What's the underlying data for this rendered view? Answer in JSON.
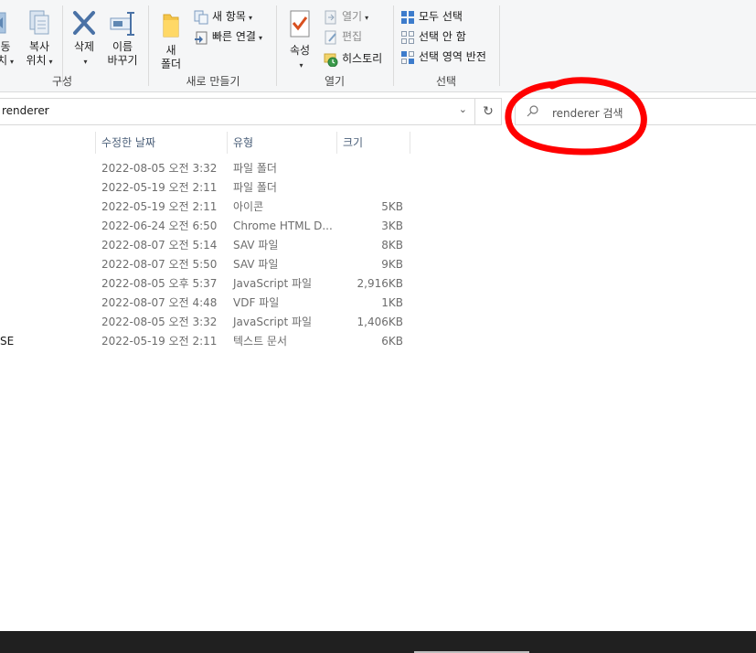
{
  "ribbon": {
    "cut_left": {
      "line1": "동",
      "line2": "치"
    },
    "copy_to": {
      "line1": "복사",
      "line2": "위치"
    },
    "delete": {
      "line1": "삭제",
      "line2": ""
    },
    "rename": {
      "line1": "이름",
      "line2": "바꾸기"
    },
    "organize_label": "구성",
    "new_folder": {
      "line1": "새",
      "line2": "폴더"
    },
    "new_item": "새 항목",
    "easy_access": "빠른 연결",
    "new_label": "새로 만들기",
    "properties": "속성",
    "open": "열기",
    "edit": "편집",
    "history": "히스토리",
    "open_label": "열기",
    "select_all": "모두 선택",
    "select_none": "선택 안 함",
    "invert_selection": "선택 영역 반전",
    "select_label": "선택"
  },
  "address": {
    "path": "renderer"
  },
  "search": {
    "placeholder": "renderer 검색"
  },
  "columns": {
    "date": "수정한 날짜",
    "type": "유형",
    "size": "크기"
  },
  "files": [
    {
      "name": "",
      "date": "2022-08-05 오전 3:32",
      "type": "파일 폴더",
      "size": ""
    },
    {
      "name": "",
      "date": "2022-05-19 오전 2:11",
      "type": "파일 폴더",
      "size": ""
    },
    {
      "name": "",
      "date": "2022-05-19 오전 2:11",
      "type": "아이콘",
      "size": "5KB"
    },
    {
      "name": "",
      "date": "2022-06-24 오전 6:50",
      "type": "Chrome HTML D...",
      "size": "3KB"
    },
    {
      "name": "",
      "date": "2022-08-07 오전 5:14",
      "type": "SAV 파일",
      "size": "8KB"
    },
    {
      "name": "",
      "date": "2022-08-07 오전 5:50",
      "type": "SAV 파일",
      "size": "9KB"
    },
    {
      "name": "",
      "date": "2022-08-05 오후 5:37",
      "type": "JavaScript 파일",
      "size": "2,916KB"
    },
    {
      "name": "",
      "date": "2022-08-07 오전 4:48",
      "type": "VDF 파일",
      "size": "1KB"
    },
    {
      "name": "",
      "date": "2022-08-05 오전 3:32",
      "type": "JavaScript 파일",
      "size": "1,406KB"
    },
    {
      "name": "SE",
      "date": "2022-05-19 오전 2:11",
      "type": "텍스트 문서",
      "size": "6KB"
    }
  ],
  "colors": {
    "annotation": "#ff0000",
    "ribbon_bg": "#f5f6f7",
    "header_text": "#4c607a"
  }
}
